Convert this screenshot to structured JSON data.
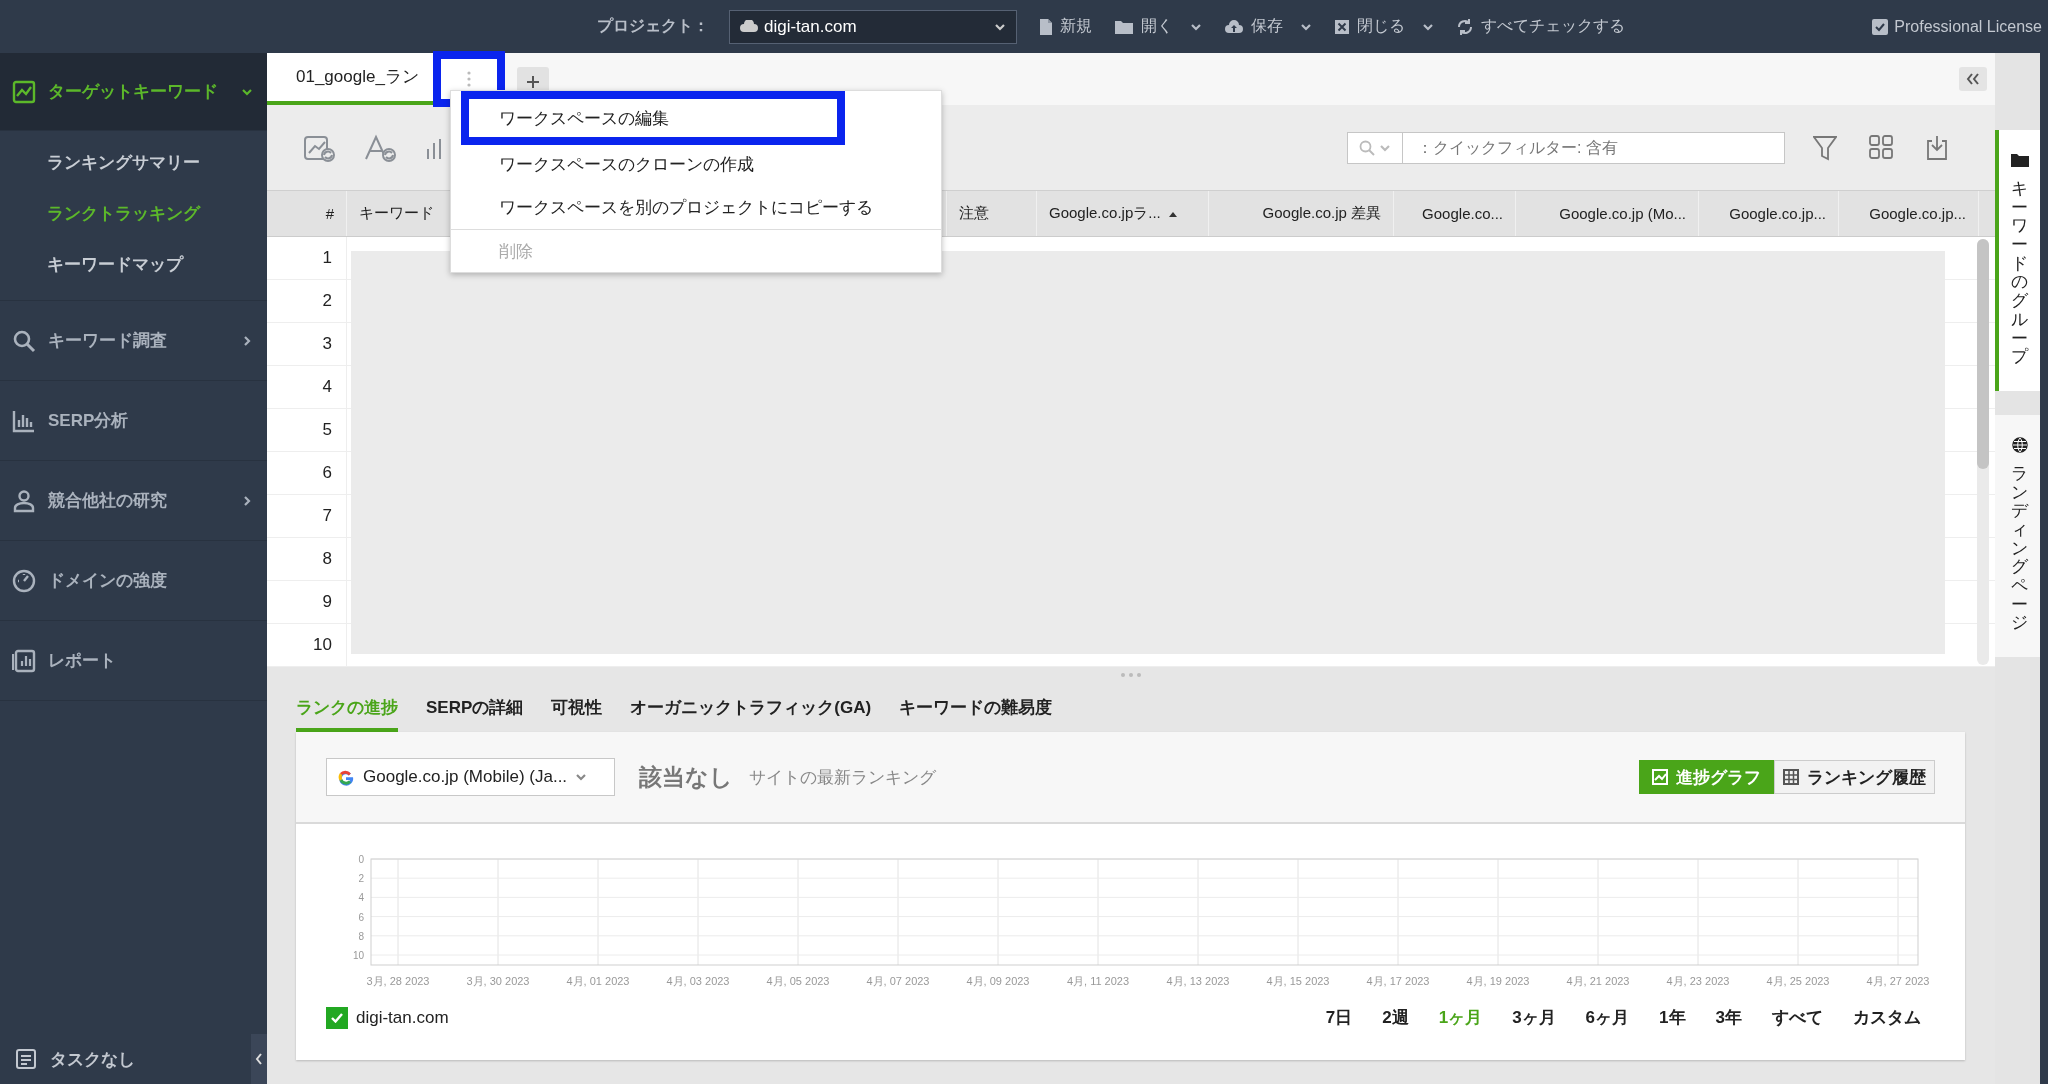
{
  "topbar": {
    "project_label": "プロジェクト：",
    "project": "digi-tan.com",
    "actions": [
      {
        "label": "新規",
        "caret": false
      },
      {
        "label": "開く",
        "caret": true
      },
      {
        "label": "保存",
        "caret": true
      },
      {
        "label": "閉じる",
        "caret": true
      },
      {
        "label": "すべてチェックする",
        "caret": false
      }
    ],
    "license": "Professional License"
  },
  "sidebar": {
    "items": [
      {
        "label": "ターゲットキーワード",
        "kind": "group",
        "expanded": true,
        "selected": true,
        "children": [
          {
            "label": "ランキングサマリー",
            "selected": false
          },
          {
            "label": "ランクトラッキング",
            "selected": true
          },
          {
            "label": "キーワードマップ",
            "selected": false
          }
        ]
      },
      {
        "label": "キーワード調査",
        "kind": "group",
        "expanded": false,
        "selected": false
      },
      {
        "label": "SERP分析",
        "kind": "link",
        "selected": false
      },
      {
        "label": "競合他社の研究",
        "kind": "group",
        "expanded": false,
        "selected": false
      },
      {
        "label": "ドメインの強度",
        "kind": "link",
        "selected": false
      },
      {
        "label": "レポート",
        "kind": "link",
        "selected": false
      }
    ],
    "footer": "タスクなし"
  },
  "workspace_tabs": [
    {
      "label": "01_google_ラン",
      "selected": true,
      "menu_outlined": true
    }
  ],
  "workspace_menu": [
    {
      "label": "ワークスペースの編集",
      "disabled": false,
      "outlined": true
    },
    {
      "label": "ワークスペースのクローンの作成",
      "disabled": false,
      "outlined": false
    },
    {
      "label": "ワークスペースを別のプロジェクトにコピーする",
      "disabled": false,
      "outlined": false
    },
    {
      "label": "削除",
      "disabled": true,
      "outlined": false
    }
  ],
  "toolbar": {
    "search_placeholder": "：クイックフィルター: 含有"
  },
  "table": {
    "columns": [
      {
        "label": "#",
        "sorted": false
      },
      {
        "label": "キーワード",
        "sorted": false
      },
      {
        "label": "注意",
        "sorted": false
      },
      {
        "label": "Google.co.jpラ...",
        "sorted": true
      },
      {
        "label": "Google.co.jp 差異",
        "sorted": false
      },
      {
        "label": "Google.co...",
        "sorted": false
      },
      {
        "label": "Google.co.jp (Mo...",
        "sorted": false
      },
      {
        "label": "Google.co.jp...",
        "sorted": false
      },
      {
        "label": "Google.co.jp...",
        "sorted": false
      }
    ],
    "rows": [
      "1",
      "2",
      "3",
      "4",
      "5",
      "6",
      "7",
      "8",
      "9",
      "10"
    ]
  },
  "right_rail": [
    {
      "label": "キーワードのグループ",
      "selected": true
    },
    {
      "label": "ランディングページ",
      "selected": false
    }
  ],
  "bottom_panel": {
    "tabs": [
      {
        "label": "ランクの進捗",
        "selected": true
      },
      {
        "label": "SERPの詳細",
        "selected": false
      },
      {
        "label": "可視性",
        "selected": false
      },
      {
        "label": "オーガニックトラフィック(GA)",
        "selected": false
      },
      {
        "label": "キーワードの難易度",
        "selected": false
      }
    ],
    "engine": "Google.co.jp (Mobile) (Ja...",
    "status": "該当なし",
    "status_note": "サイトの最新ランキング",
    "views": [
      {
        "label": "進捗グラフ",
        "selected": true
      },
      {
        "label": "ランキング履歴",
        "selected": false
      }
    ],
    "chart_data": {
      "type": "line",
      "grid": true,
      "ylim": [
        10,
        0
      ],
      "categories": [
        "3月, 28 2023",
        "3月, 30 2023",
        "4月, 01 2023",
        "4月, 03 2023",
        "4月, 05 2023",
        "4月, 07 2023",
        "4月, 09 2023",
        "4月, 11 2023",
        "4月, 13 2023",
        "4月, 15 2023",
        "4月, 17 2023",
        "4月, 19 2023",
        "4月, 21 2023",
        "4月, 23 2023",
        "4月, 25 2023",
        "4月, 27 2023"
      ],
      "yticks": [
        0,
        2,
        4,
        6,
        8,
        10
      ],
      "series": [
        {
          "name": "digi-tan.com",
          "color": "#22a822",
          "values": [
            null,
            null,
            null,
            null,
            null,
            null,
            null,
            null,
            null,
            null,
            null,
            null,
            null,
            null,
            null,
            null
          ]
        }
      ]
    },
    "legend_checked": true,
    "ranges": [
      {
        "label": "7日",
        "selected": false
      },
      {
        "label": "2週",
        "selected": false
      },
      {
        "label": "1ヶ月",
        "selected": true
      },
      {
        "label": "3ヶ月",
        "selected": false
      },
      {
        "label": "6ヶ月",
        "selected": false
      },
      {
        "label": "1年",
        "selected": false
      },
      {
        "label": "3年",
        "selected": false
      },
      {
        "label": "すべて",
        "selected": false
      },
      {
        "label": "カスタム",
        "selected": false
      }
    ]
  }
}
